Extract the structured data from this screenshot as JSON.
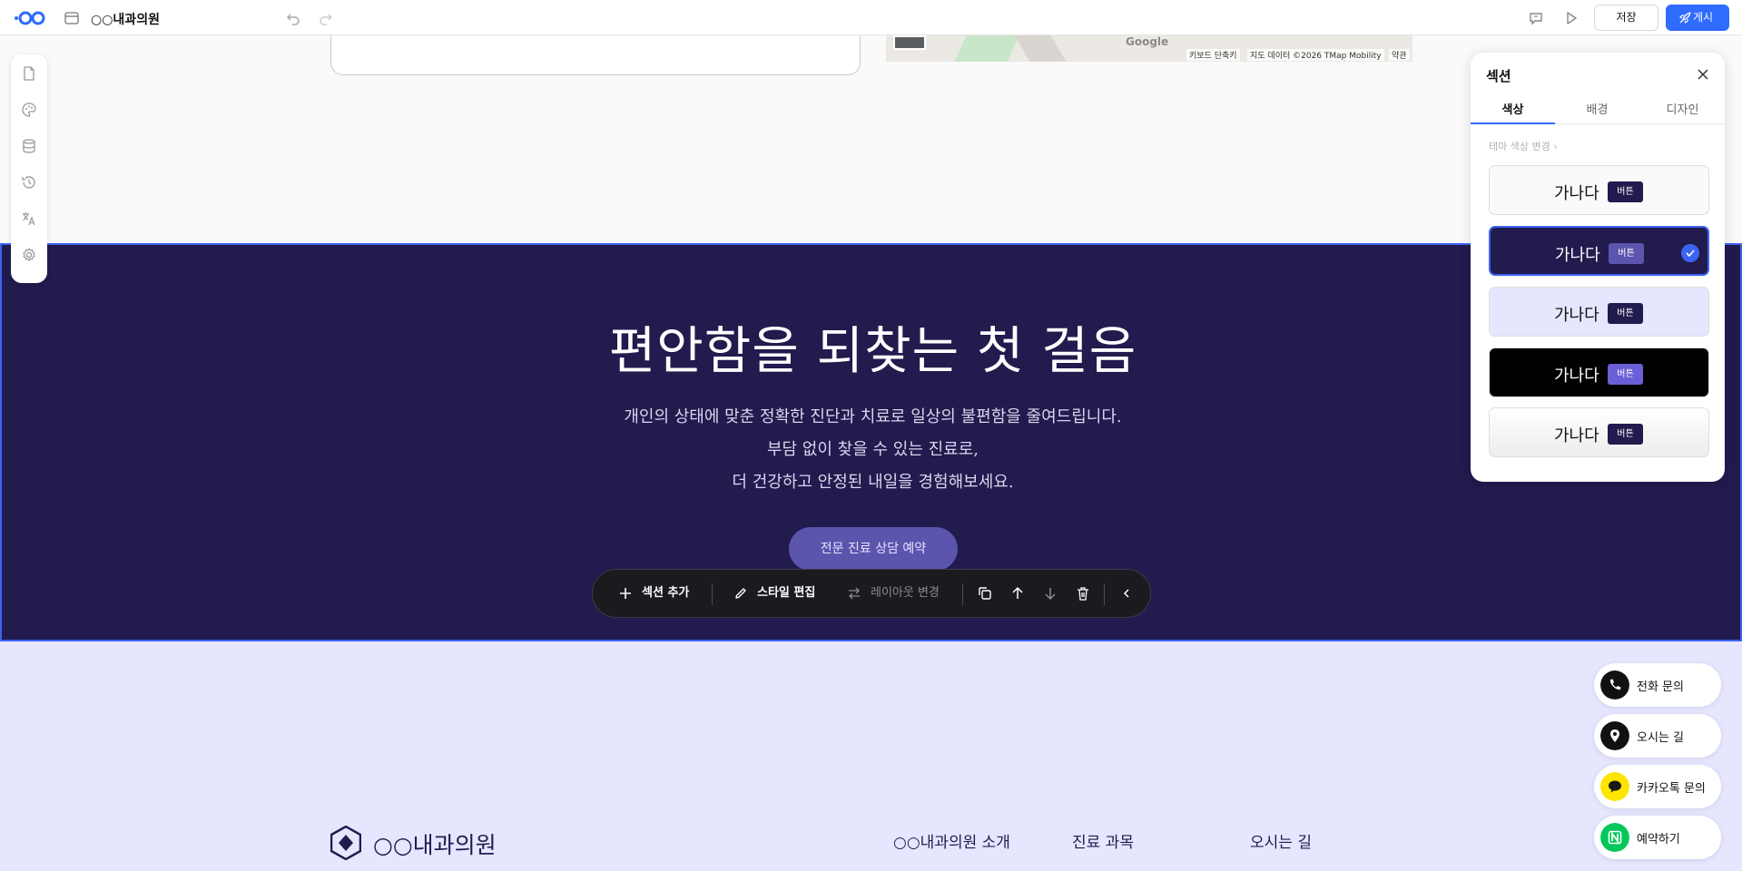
{
  "topbar": {
    "site_title": "○○내과의원",
    "save_label": "저장",
    "publish_label": "게시"
  },
  "left_rail": {
    "icons": [
      "page-icon",
      "palette-icon",
      "database-icon",
      "history-icon",
      "translate-icon",
      "settings-icon"
    ]
  },
  "map": {
    "google_label": "Google",
    "shortcuts_label": "키보드 단축키",
    "data_label": "지도 데이터 ©2026 TMap Mobility",
    "terms_label": "약관"
  },
  "hero": {
    "title": "편안함을 되찾는 첫 걸음",
    "desc_line1": "개인의 상태에 맞춘 정확한 진단과 치료로 일상의 불편함을 줄여드립니다.",
    "desc_line2": "부담 없이 찾을 수 있는 진료로,",
    "desc_line3": "더 건강하고 안정된 내일을 경험해보세요.",
    "cta_label": "전문 진료 상담 예약",
    "bg_color": "#211b4e",
    "cta_color": "#5b55ad"
  },
  "floating_toolbar": {
    "add_section_label": "섹션 추가",
    "edit_style_label": "스타일 편집",
    "change_layout_label": "레이아웃 변경"
  },
  "footer": {
    "clinic_name": "○○내과의원",
    "links": [
      "○○내과의원 소개",
      "진료 과목",
      "오시는 길"
    ],
    "bg_color": "#e6e6ff"
  },
  "contact_buttons": [
    {
      "label": "전화 문의",
      "icon": "phone-icon"
    },
    {
      "label": "오시는 길",
      "icon": "location-pin-icon"
    },
    {
      "label": "카카오톡 문의",
      "icon": "kakao-chat-icon"
    },
    {
      "label": "예약하기",
      "icon": "naver-booking-icon"
    }
  ],
  "panel": {
    "title": "섹션",
    "tabs": [
      "색상",
      "배경",
      "디자인"
    ],
    "active_tab": "색상",
    "theme_link": "테마 색상 변경",
    "swatches": [
      {
        "text": "가나다",
        "button": "버튼",
        "bg": "#fafafa",
        "text_color": "#111111",
        "btn_bg": "#211b4e",
        "btn_color": "#ffffff",
        "selected": false
      },
      {
        "text": "가나다",
        "button": "버튼",
        "bg": "#211b4e",
        "text_color": "#ffffff",
        "btn_bg": "#5b55ad",
        "btn_color": "#ffffff",
        "selected": true
      },
      {
        "text": "가나다",
        "button": "버튼",
        "bg": "#e6e6ff",
        "text_color": "#111111",
        "btn_bg": "#211b4e",
        "btn_color": "#ffffff",
        "selected": false
      },
      {
        "text": "가나다",
        "button": "버튼",
        "bg": "#000000",
        "text_color": "#ffffff",
        "btn_bg": "#6a5fd6",
        "btn_color": "#ffffff",
        "selected": false
      },
      {
        "text": "가나다",
        "button": "버튼",
        "bg": "#ededed",
        "text_color": "#111111",
        "btn_bg": "#211b4e",
        "btn_color": "#ffffff",
        "selected": false
      }
    ]
  },
  "colors": {
    "accent": "#2f6bff",
    "selection_border": "#3d63f2"
  }
}
